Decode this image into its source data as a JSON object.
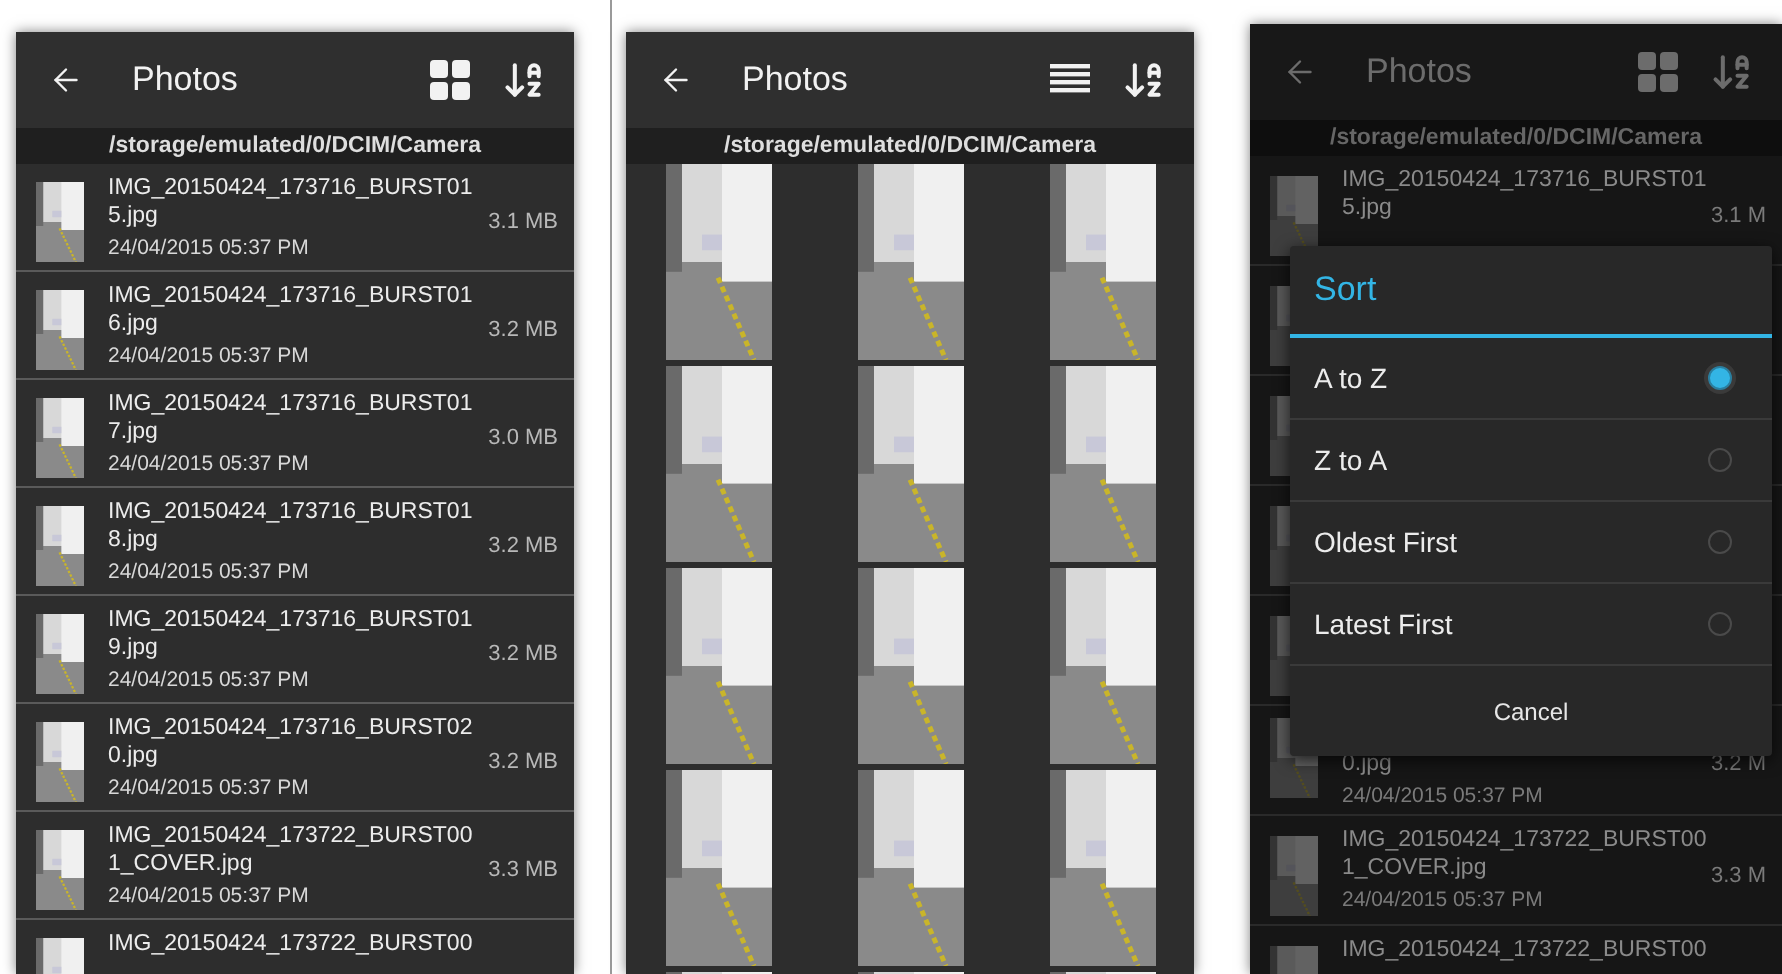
{
  "screens": [
    {
      "kind": "list",
      "title": "Photos",
      "view_toggle": {
        "kind": "grid"
      },
      "path": "/storage/emulated/0/DCIM/Camera",
      "dimmed": false,
      "rows": [
        {
          "kind": "item",
          "name": [
            "IMG_20150424_173716_BURST01",
            "5.jpg"
          ],
          "size": "3.1 MB",
          "date": "24/04/2015 05:37 PM"
        },
        {
          "kind": "item",
          "name": [
            "IMG_20150424_173716_BURST01",
            "6.jpg"
          ],
          "size": "3.2 MB",
          "date": "24/04/2015 05:37 PM"
        },
        {
          "kind": "item",
          "name": [
            "IMG_20150424_173716_BURST01",
            "7.jpg"
          ],
          "size": "3.0 MB",
          "date": "24/04/2015 05:37 PM"
        },
        {
          "kind": "item",
          "name": [
            "IMG_20150424_173716_BURST01",
            "8.jpg"
          ],
          "size": "3.2 MB",
          "date": "24/04/2015 05:37 PM"
        },
        {
          "kind": "item",
          "name": [
            "IMG_20150424_173716_BURST01",
            "9.jpg"
          ],
          "size": "3.2 MB",
          "date": "24/04/2015 05:37 PM"
        },
        {
          "kind": "item",
          "name": [
            "IMG_20150424_173716_BURST02",
            "0.jpg"
          ],
          "size": "3.2 MB",
          "date": "24/04/2015 05:37 PM"
        },
        {
          "kind": "item",
          "name": [
            "IMG_20150424_173722_BURST00",
            "1_COVER.jpg"
          ],
          "size": "3.3 MB",
          "date": "24/04/2015 05:37 PM"
        },
        {
          "kind": "item",
          "name": [
            "IMG_20150424_173722_BURST00"
          ]
        }
      ]
    },
    {
      "kind": "grid",
      "title": "Photos",
      "view_toggle": {
        "kind": "list"
      },
      "path": "/storage/emulated/0/DCIM/Camera",
      "dimmed": false,
      "photos": [
        {
          "kind": "photo"
        },
        {
          "kind": "photo"
        },
        {
          "kind": "photo"
        },
        {
          "kind": "photo"
        },
        {
          "kind": "photo"
        },
        {
          "kind": "photo"
        },
        {
          "kind": "photo"
        },
        {
          "kind": "photo"
        },
        {
          "kind": "photo"
        },
        {
          "kind": "photo"
        },
        {
          "kind": "photo"
        },
        {
          "kind": "photo"
        },
        {
          "kind": "photo"
        },
        {
          "kind": "photo"
        },
        {
          "kind": "photo"
        }
      ]
    },
    {
      "kind": "list",
      "title": "Photos",
      "view_toggle": {
        "kind": "grid"
      },
      "path": "/storage/emulated/0/DCIM/Camera",
      "dimmed": true,
      "rows": [
        {
          "kind": "item",
          "name": [
            "IMG_20150424_173716_BURST01",
            "5.jpg"
          ],
          "size": "3.1 M"
        },
        {
          "kind": "covered"
        },
        {
          "kind": "covered"
        },
        {
          "kind": "covered"
        },
        {
          "kind": "covered"
        },
        {
          "kind": "tail",
          "name": [
            "0.jpg"
          ],
          "size": "3.2 M",
          "date": "24/04/2015 05:37 PM"
        },
        {
          "kind": "item",
          "name": [
            "IMG_20150424_173722_BURST00",
            "1_COVER.jpg"
          ],
          "size": "3.3 M",
          "date": "24/04/2015 05:37 PM"
        },
        {
          "kind": "item",
          "name": [
            "IMG_20150424_173722_BURST00"
          ]
        }
      ],
      "dialog": {
        "title": "Sort",
        "options": [
          {
            "label": "A to Z",
            "selected": true
          },
          {
            "label": "Z to A",
            "selected": false
          },
          {
            "label": "Oldest First",
            "selected": false
          },
          {
            "label": "Latest First",
            "selected": false
          }
        ],
        "cancel": "Cancel"
      }
    }
  ]
}
